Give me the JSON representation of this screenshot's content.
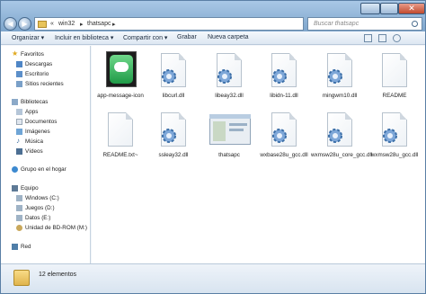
{
  "address": {
    "crumbs": [
      "win32",
      "thatsapc"
    ]
  },
  "search": {
    "placeholder": "Buscar thatsapc"
  },
  "toolbar": {
    "organize": "Organizar ▾",
    "include": "Incluir en biblioteca ▾",
    "share": "Compartir con ▾",
    "burn": "Grabar",
    "new_folder": "Nueva carpeta"
  },
  "nav": {
    "favorites": "Favoritos",
    "downloads": "Descargas",
    "desktop": "Escritorio",
    "recent": "Sitios recientes",
    "libraries": "Bibliotecas",
    "apps": "Apps",
    "documents": "Documentos",
    "images": "Imágenes",
    "music": "Música",
    "videos": "Vídeos",
    "homegroup": "Grupo en el hogar",
    "computer": "Equipo",
    "drive_c": "Windows (C:)",
    "drive_d": "Juegos (D:)",
    "drive_e": "Datos (E:)",
    "drive_m": "Unidad de BD-ROM (M:)",
    "network": "Red"
  },
  "files": [
    {
      "name": "app-message-icon",
      "type": "image"
    },
    {
      "name": "libcurl.dll",
      "type": "dll"
    },
    {
      "name": "libeay32.dll",
      "type": "dll"
    },
    {
      "name": "libidn-11.dll",
      "type": "dll"
    },
    {
      "name": "mingwm10.dll",
      "type": "dll"
    },
    {
      "name": "README",
      "type": "doc"
    },
    {
      "name": "README.txt~",
      "type": "doc"
    },
    {
      "name": "ssleay32.dll",
      "type": "dll"
    },
    {
      "name": "thatsapc",
      "type": "app"
    },
    {
      "name": "wxbase28u_gcc.dll",
      "type": "dll"
    },
    {
      "name": "wxmsw28u_core_gcc.dll",
      "type": "dll"
    },
    {
      "name": "wxmsw28u_gcc.dll",
      "type": "dll"
    }
  ],
  "status": {
    "count": "12 elementos"
  },
  "colors": {
    "titlebar": "#8fb4d8",
    "accent": "#2f6fb0"
  }
}
